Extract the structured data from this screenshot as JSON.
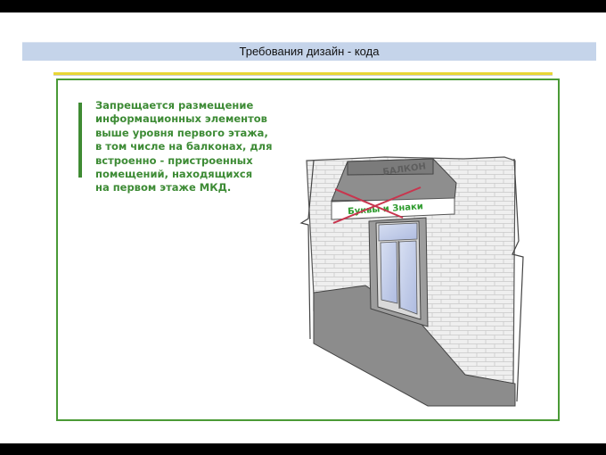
{
  "slide": {
    "title": "Требования дизайн - кода",
    "rule_lines": [
      "Запрещается размещение",
      "информационных элементов",
      "выше уровня первого этажа,",
      "в том числе на балконах, для",
      "встроенно - пристроенных",
      "помещений, находящихся",
      "на первом этаже МКД."
    ]
  },
  "illustration": {
    "balcony_label": "БАЛКОН",
    "sign_label": "Буквы и Знаки",
    "cross_color": "#c9354e",
    "sign_text_color": "#2e9b2e"
  },
  "colors": {
    "title_bar": "#c5d4ea",
    "frame": "#4a9a36",
    "text_green": "#3d8b35",
    "underline": "#e9d635",
    "wall": "#eeeeee",
    "ground": "#8c8c8c"
  }
}
